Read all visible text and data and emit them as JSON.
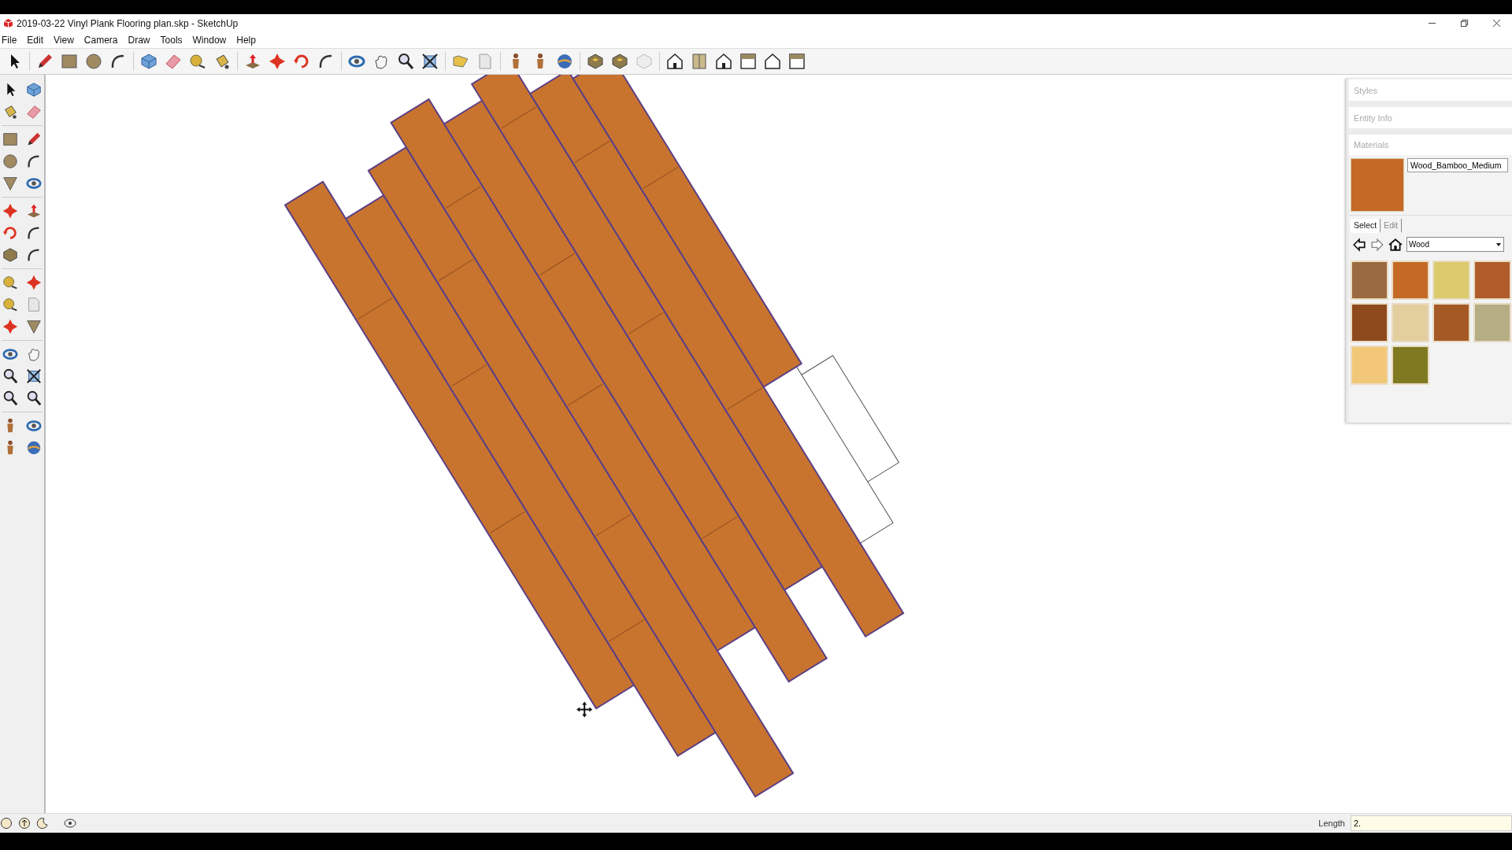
{
  "window": {
    "title": "2019-03-22 Vinyl Plank Flooring plan.skp - SketchUp"
  },
  "menu": [
    "File",
    "Edit",
    "View",
    "Camera",
    "Draw",
    "Tools",
    "Window",
    "Help"
  ],
  "trays": [
    {
      "title": "Styles"
    },
    {
      "title": "Entity Info"
    }
  ],
  "materials": {
    "title": "Materials",
    "name": "Wood_Bamboo_Medium",
    "tabs": [
      {
        "label": "Select",
        "selected": true
      },
      {
        "label": "Edit",
        "selected": false
      }
    ],
    "library": "Wood",
    "swatches": [
      {
        "color": "#9a6a40"
      },
      {
        "color": "#c46a26"
      },
      {
        "color": "#dccb6c"
      },
      {
        "color": "#b05c2a"
      },
      {
        "color": "#8e4a1c"
      },
      {
        "color": "#e3cf9e"
      },
      {
        "color": "#a55a25"
      },
      {
        "color": "#b5ad84"
      },
      {
        "color": "#f2c878"
      },
      {
        "color": "#7f7a22"
      }
    ]
  },
  "status_bar": {
    "measure_label": "Length",
    "measure_value": "2."
  }
}
